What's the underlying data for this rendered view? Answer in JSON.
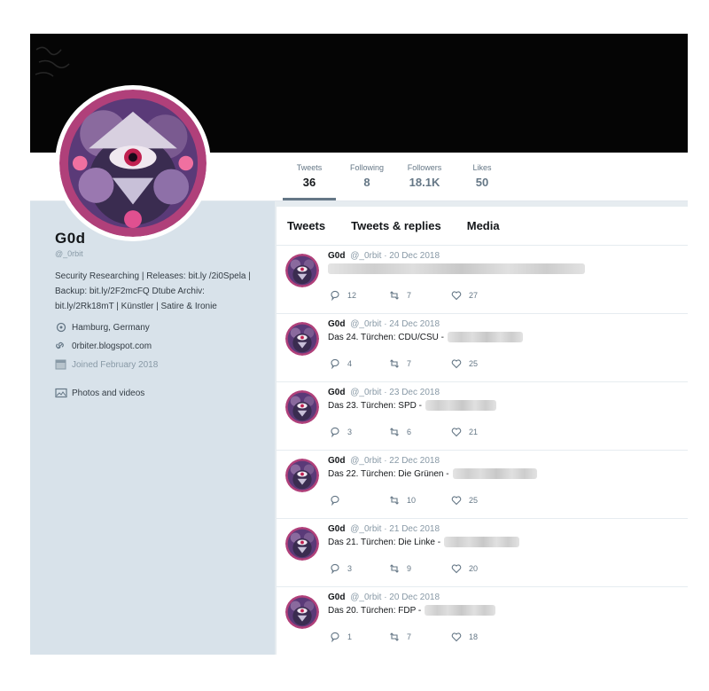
{
  "profile": {
    "name": "G0d",
    "handle": "@_0rbit",
    "bio": "Security Researching | Releases: bit.ly /2i0Spela | Backup: bit.ly/2F2mcFQ Dtube Archiv: bit.ly/2Rk18mT | Künstler | Satire & Ironie",
    "location": "Hamburg, Germany",
    "website": "0rbiter.blogspot.com",
    "joined": "Joined February 2018",
    "photos_label": "Photos and videos"
  },
  "stats": [
    {
      "label": "Tweets",
      "value": "36"
    },
    {
      "label": "Following",
      "value": "8"
    },
    {
      "label": "Followers",
      "value": "18.1K"
    },
    {
      "label": "Likes",
      "value": "50"
    }
  ],
  "tabs": [
    "Tweets",
    "Tweets & replies",
    "Media"
  ],
  "tweets": [
    {
      "name": "G0d",
      "handle": "@_0rbit",
      "date": "· 20 Dec 2018",
      "text": "",
      "replies": "12",
      "retweets": "7",
      "likes": "27"
    },
    {
      "name": "G0d",
      "handle": "@_0rbit",
      "date": "· 24 Dec 2018",
      "text": "Das 24. Türchen: CDU/CSU -",
      "replies": "4",
      "retweets": "7",
      "likes": "25"
    },
    {
      "name": "G0d",
      "handle": "@_0rbit",
      "date": "· 23 Dec 2018",
      "text": "Das 23. Türchen: SPD -",
      "replies": "3",
      "retweets": "6",
      "likes": "21"
    },
    {
      "name": "G0d",
      "handle": "@_0rbit",
      "date": "· 22 Dec 2018",
      "text": "Das 22. Türchen: Die Grünen -",
      "replies": "",
      "retweets": "10",
      "likes": "25"
    },
    {
      "name": "G0d",
      "handle": "@_0rbit",
      "date": "· 21 Dec 2018",
      "text": "Das 21. Türchen: Die Linke -",
      "replies": "3",
      "retweets": "9",
      "likes": "20"
    },
    {
      "name": "G0d",
      "handle": "@_0rbit",
      "date": "· 20 Dec 2018",
      "text": "Das 20. Türchen: FDP -",
      "replies": "1",
      "retweets": "7",
      "likes": "18"
    }
  ],
  "colors": {
    "banner": "#050505",
    "sidebar": "#d8e2ea",
    "text": "#14171a",
    "muted": "#8899a6"
  }
}
